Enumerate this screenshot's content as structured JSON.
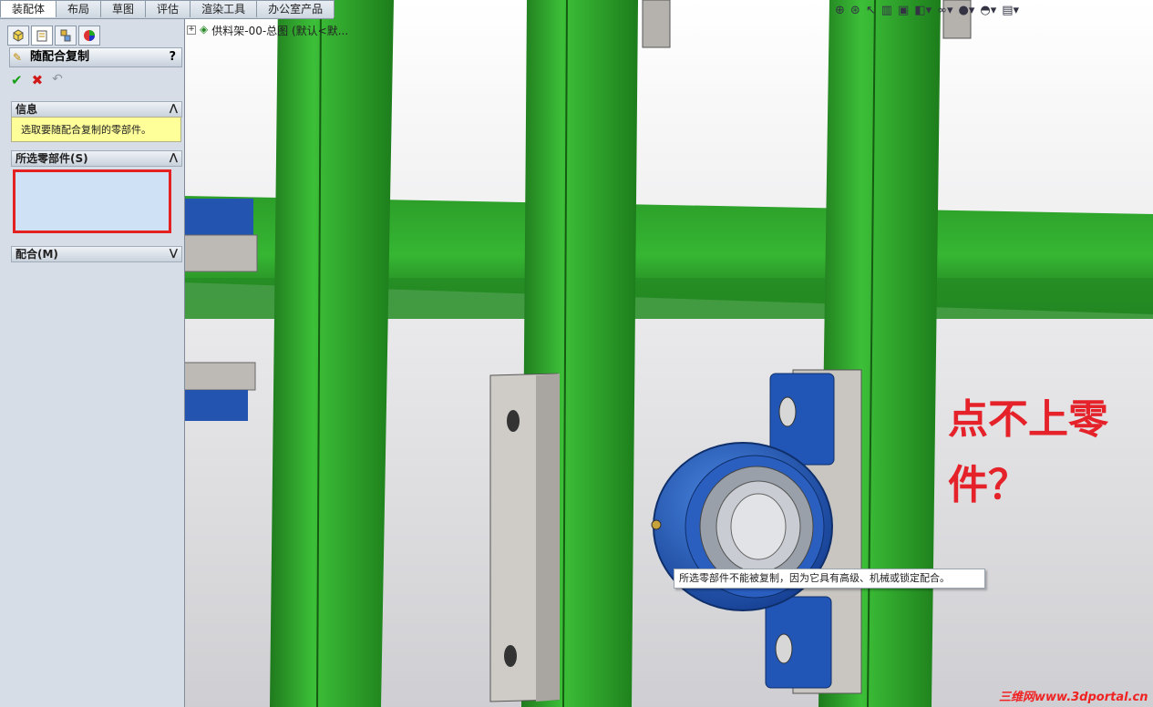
{
  "tabs": [
    "装配体",
    "布局",
    "草图",
    "评估",
    "渲染工具",
    "办公室产品"
  ],
  "panel": {
    "title": "随配合复制",
    "help": "?",
    "info_header": "信息",
    "info_text": "选取要随配合复制的零部件。",
    "selected_header": "所选零部件(S)",
    "mates_header": "配合(M)",
    "collapse_glyph": "⋀",
    "expand_glyph": "⋁"
  },
  "tree": {
    "expand": "+",
    "root_label": "供料架-00-总图 (默认<默..."
  },
  "tooltip": "所选零部件不能被复制，因为它具有高级、机械或锁定配合。",
  "annotation": {
    "line1": "点不上零",
    "line2": "件？"
  },
  "watermark": "三维网www.3dportal.cn",
  "colors": {
    "frame_green": "#2fa72c",
    "bearing_blue": "#2259b8",
    "plate_gray": "#c8c6c1",
    "annotation_red": "#e5222a"
  },
  "icons": [
    "assembly-icon",
    "property-icon",
    "config-icon",
    "display-icon",
    "zoom-fit-icon",
    "zoom-area-icon",
    "previous-view-icon",
    "section-view-icon",
    "view-orientation-icon",
    "display-style-icon",
    "hide-show-icon",
    "appearance-icon",
    "scene-icon",
    "view-settings-icon"
  ]
}
